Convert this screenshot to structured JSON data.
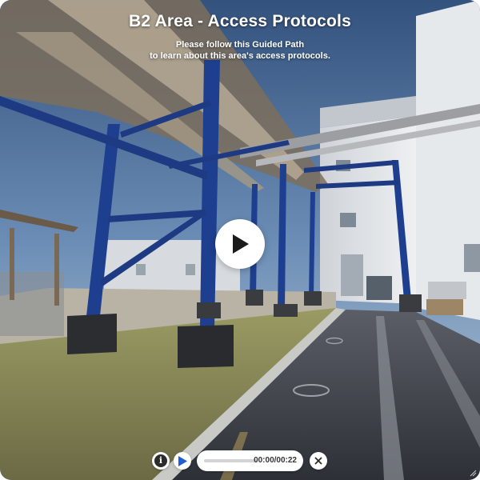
{
  "header": {
    "title": "B2 Area - Access Protocols",
    "subtitle_line1": "Please follow this Guided Path",
    "subtitle_line2": "to learn about this area's access protocols."
  },
  "player": {
    "progress": 0,
    "current_time": "00:00",
    "duration": "00:22",
    "time_display": "00:00/00:22"
  },
  "colors": {
    "accent": "#1f5fd6",
    "sky": "#6f8fb3",
    "steel_beam": "#1e3f8f",
    "pavement": "#3a3d45",
    "grass": "#8c8f55"
  },
  "icons": {
    "big_play": "play-icon",
    "info": "info-icon",
    "small_play": "play-icon",
    "close": "close-icon"
  }
}
